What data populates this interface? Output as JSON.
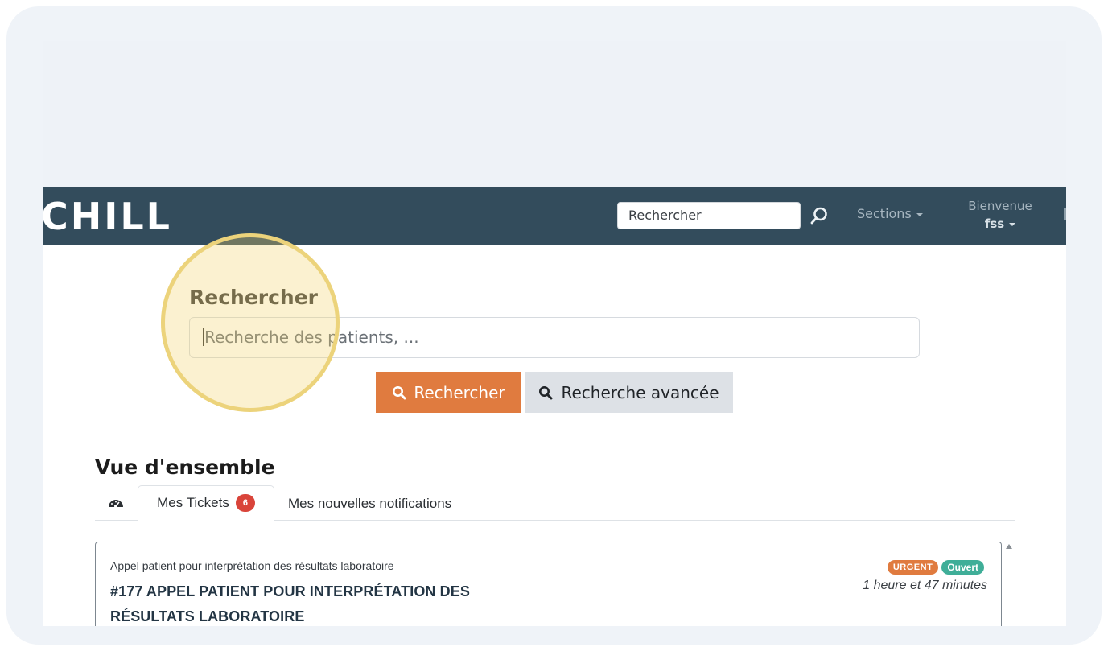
{
  "navbar": {
    "logo": "CHILL",
    "search_placeholder": "Rechercher",
    "sections_label": "Sections",
    "welcome_label": "Bienvenue",
    "user_name": "fss",
    "background_color": "#334c5c"
  },
  "search": {
    "title": "Rechercher",
    "placeholder": "Recherche des patients, ...",
    "submit_label": "Rechercher",
    "advanced_label": "Recherche avancée",
    "submit_color": "#e07b3f"
  },
  "overview": {
    "title": "Vue d'ensemble",
    "tabs": [
      {
        "icon": "dashboard-icon"
      },
      {
        "label": "Mes Tickets",
        "count": "6",
        "active": true
      },
      {
        "label": "Mes nouvelles notifications"
      }
    ]
  },
  "ticket": {
    "caption": "Appel patient pour interprétation des résultats laboratoire",
    "title": "#177 APPEL PATIENT POUR INTERPRÉTATION DES RÉSULTATS LABORATOIRE",
    "urgency": "URGENT",
    "status": "Ouvert",
    "elapsed": "1 heure et 47 minutes"
  }
}
